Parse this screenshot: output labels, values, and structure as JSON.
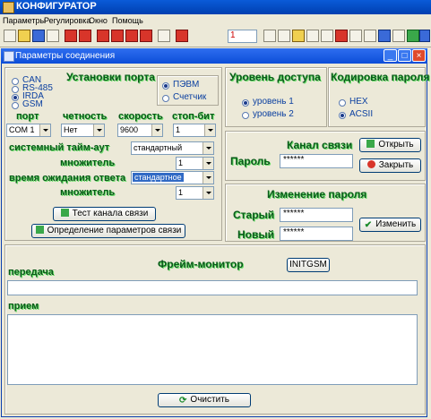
{
  "app": {
    "title": "КОНФИГУРАТОР",
    "menu": [
      "Параметры",
      "Регулировка",
      "Окно",
      "Помощь"
    ],
    "toolbar_field": "1"
  },
  "dialog": {
    "title": "Параметры соединения"
  },
  "port_settings": {
    "heading": "Установки порта",
    "interfaces": [
      "CAN",
      "RS-485",
      "IRDA",
      "GSM"
    ],
    "selected_interface": "IRDA",
    "targets": [
      "ПЭВМ",
      "Счетчик"
    ],
    "selected_target": "ПЭВМ",
    "labels": {
      "port": "порт",
      "parity": "четность",
      "speed": "скорость",
      "stop_bit": "стоп-бит"
    },
    "values": {
      "port": "COM 1",
      "parity": "Нет",
      "speed": "9600",
      "stop_bit": "1"
    },
    "sys_timeout_label": "системный тайм-аут",
    "sys_timeout_value": "стандартный",
    "multiplier_label": "множитель",
    "sys_timeout_mult": "1",
    "response_wait_label": "время ожидания ответа",
    "response_wait_value": "стандартное",
    "response_wait_mult": "1",
    "test_button": "Тест канала связи",
    "detect_button": "Определение параметров связи"
  },
  "access": {
    "heading": "Уровень доступа",
    "options": [
      "уровень 1",
      "уровень 2"
    ],
    "selected": "уровень 1"
  },
  "encoding": {
    "heading": "Кодировка пароля",
    "options": [
      "HEX",
      "ACSII"
    ],
    "selected": "ACSII"
  },
  "channel": {
    "heading": "Канал связи",
    "password_label": "Пароль",
    "password_value": "******",
    "open_button": "Открыть",
    "close_button": "Закрыть"
  },
  "change_password": {
    "heading": "Изменение пароля",
    "old_label": "Старый",
    "old_value": "******",
    "new_label": "Новый",
    "new_value": "******",
    "change_button": "Изменить"
  },
  "monitor": {
    "heading": "Фрейм-монитор",
    "init_button": "INITGSM",
    "send_label": "передача",
    "recv_label": "прием",
    "clear_button": "Очистить"
  }
}
